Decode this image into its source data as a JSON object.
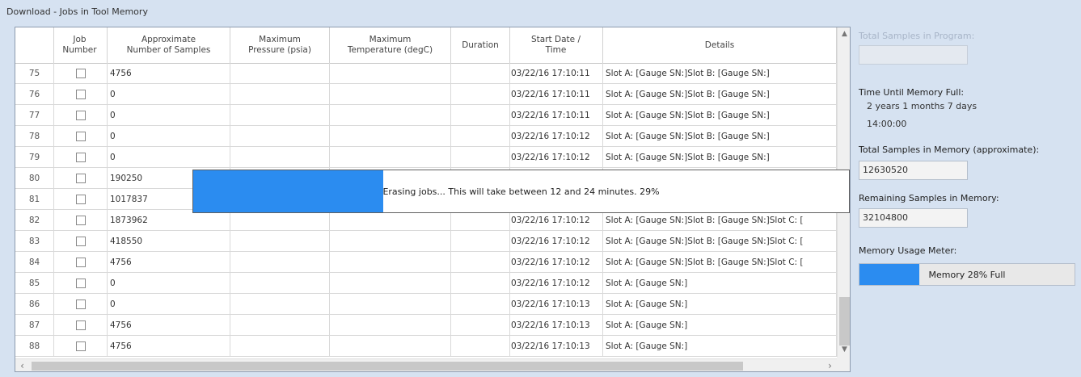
{
  "group_title": "Download - Jobs in Tool Memory",
  "table": {
    "columns": [
      "Job\nNumber",
      "Approximate\nNumber of Samples",
      "Maximum\nPressure (psia)",
      "Maximum\nTemperature (degC)",
      "Duration",
      "Start Date /\nTime",
      "Details"
    ],
    "rows": [
      {
        "index": "75",
        "samples": "4756",
        "pressure": "",
        "temperature": "",
        "duration": "",
        "start": "03/22/16 17:10:11",
        "details": "Slot A: [Gauge SN:]Slot B: [Gauge SN:]"
      },
      {
        "index": "76",
        "samples": "0",
        "pressure": "",
        "temperature": "",
        "duration": "",
        "start": "03/22/16 17:10:11",
        "details": "Slot A: [Gauge SN:]Slot B: [Gauge SN:]"
      },
      {
        "index": "77",
        "samples": "0",
        "pressure": "",
        "temperature": "",
        "duration": "",
        "start": "03/22/16 17:10:11",
        "details": "Slot A: [Gauge SN:]Slot B: [Gauge SN:]"
      },
      {
        "index": "78",
        "samples": "0",
        "pressure": "",
        "temperature": "",
        "duration": "",
        "start": "03/22/16 17:10:12",
        "details": "Slot A: [Gauge SN:]Slot B: [Gauge SN:]"
      },
      {
        "index": "79",
        "samples": "0",
        "pressure": "",
        "temperature": "",
        "duration": "",
        "start": "03/22/16 17:10:12",
        "details": "Slot A: [Gauge SN:]Slot B: [Gauge SN:]"
      },
      {
        "index": "80",
        "samples": "190250",
        "pressure": "",
        "temperature": "",
        "duration": "",
        "start": "",
        "details": ""
      },
      {
        "index": "81",
        "samples": "1017837",
        "pressure": "",
        "temperature": "",
        "duration": "",
        "start": "",
        "details": ""
      },
      {
        "index": "82",
        "samples": "1873962",
        "pressure": "",
        "temperature": "",
        "duration": "",
        "start": "03/22/16 17:10:12",
        "details": "Slot A: [Gauge SN:]Slot B: [Gauge SN:]Slot C: ["
      },
      {
        "index": "83",
        "samples": "418550",
        "pressure": "",
        "temperature": "",
        "duration": "",
        "start": "03/22/16 17:10:12",
        "details": "Slot A: [Gauge SN:]Slot B: [Gauge SN:]Slot C: ["
      },
      {
        "index": "84",
        "samples": "4756",
        "pressure": "",
        "temperature": "",
        "duration": "",
        "start": "03/22/16 17:10:12",
        "details": "Slot A: [Gauge SN:]Slot B: [Gauge SN:]Slot C: ["
      },
      {
        "index": "85",
        "samples": "0",
        "pressure": "",
        "temperature": "",
        "duration": "",
        "start": "03/22/16 17:10:12",
        "details": "Slot A: [Gauge SN:]"
      },
      {
        "index": "86",
        "samples": "0",
        "pressure": "",
        "temperature": "",
        "duration": "",
        "start": "03/22/16 17:10:13",
        "details": "Slot A: [Gauge SN:]"
      },
      {
        "index": "87",
        "samples": "4756",
        "pressure": "",
        "temperature": "",
        "duration": "",
        "start": "03/22/16 17:10:13",
        "details": "Slot A: [Gauge SN:]"
      },
      {
        "index": "88",
        "samples": "4756",
        "pressure": "",
        "temperature": "",
        "duration": "",
        "start": "03/22/16 17:10:13",
        "details": "Slot A: [Gauge SN:]"
      }
    ]
  },
  "progress": {
    "text": "Erasing jobs... This will take between 12 and 24 minutes. 29%",
    "percent": 29
  },
  "side": {
    "total_in_program_label": "Total Samples in Program:",
    "total_in_program_value": "",
    "time_until_full_label": "Time Until Memory Full:",
    "time_until_full_value": "2 years 1 months 7 days",
    "time_until_full_time": "14:00:00",
    "total_in_memory_label": "Total Samples in Memory (approximate):",
    "total_in_memory_value": "12630520",
    "remaining_label": "Remaining Samples in Memory:",
    "remaining_value": "32104800",
    "meter_label": "Memory Usage Meter:",
    "meter_text": "Memory 28% Full",
    "meter_percent": 28
  },
  "colors": {
    "accent": "#2b8cf0",
    "window_bg": "#d6e2f1"
  }
}
